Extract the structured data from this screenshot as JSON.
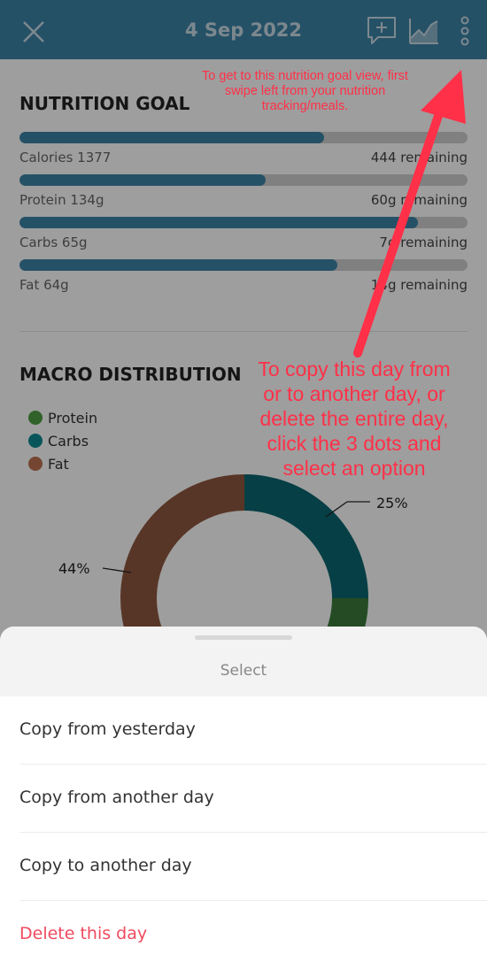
{
  "header": {
    "date": "4 Sep 2022",
    "bg_color": "#3d83a7"
  },
  "icons": {
    "close": "close-icon",
    "chat": "chat-plus-icon",
    "chart": "trend-chart-icon",
    "more": "more-vertical-icon"
  },
  "nutrition_goal": {
    "title": "NUTRITION GOAL",
    "items": [
      {
        "label": "Calories 1377",
        "remaining": "444 remaining",
        "progress": 0.68,
        "color": "#3d83a7"
      },
      {
        "label": "Protein 134g",
        "remaining": "60g remaining",
        "progress": 0.55,
        "color": "#3d83a7"
      },
      {
        "label": "Carbs 65g",
        "remaining": "7g remaining",
        "progress": 0.89,
        "color": "#3d83a7"
      },
      {
        "label": "Fat 64g",
        "remaining": "14g remaining",
        "progress": 0.71,
        "color": "#3d83a7"
      }
    ]
  },
  "macro_distribution": {
    "title": "MACRO DISTRIBUTION",
    "legend": [
      {
        "label": "Protein",
        "color": "#4f9f43"
      },
      {
        "label": "Carbs",
        "color": "#0d8c92"
      },
      {
        "label": "Fat",
        "color": "#bb7250"
      }
    ],
    "labels": {
      "carbs": "25%",
      "fat": "44%"
    }
  },
  "chart_data": {
    "type": "pie",
    "categories": [
      "Carbs",
      "Protein",
      "Fat"
    ],
    "values": [
      25,
      31,
      44
    ],
    "colors": [
      "#0a6670",
      "#3b7a3a",
      "#8f5740"
    ]
  },
  "annotations": {
    "note_top": "To get to this nutrition goal view, first swipe left from your nutrition tracking/meals.",
    "note_main": "To copy this day from or to another day, or delete the entire day, click the 3 dots and select an option",
    "color": "#ff3048"
  },
  "sheet": {
    "title": "Select",
    "options": [
      {
        "label": "Copy from yesterday",
        "color": "#333333"
      },
      {
        "label": "Copy from another day",
        "color": "#333333"
      },
      {
        "label": "Copy to another day",
        "color": "#333333"
      },
      {
        "label": "Delete this day",
        "color": "#f04a5f"
      }
    ]
  }
}
